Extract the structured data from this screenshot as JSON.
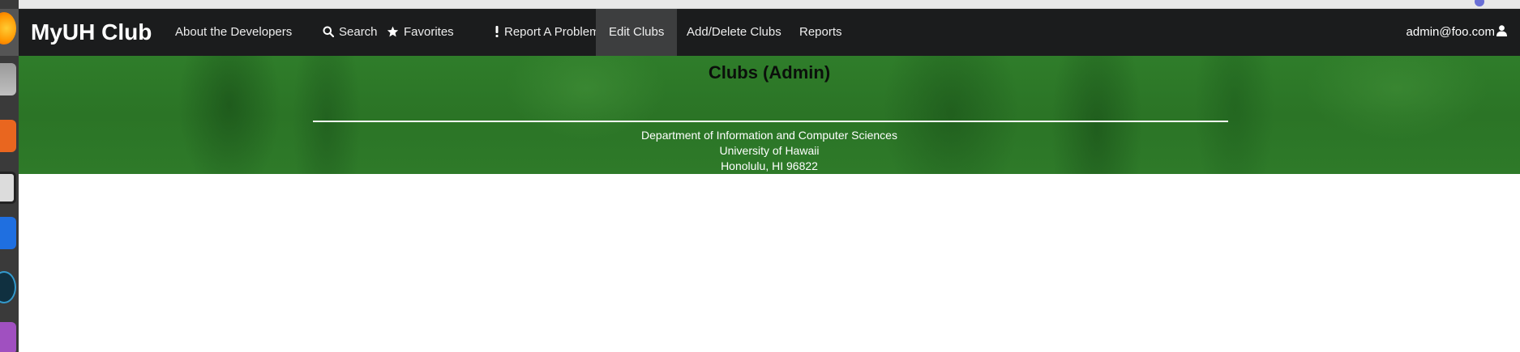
{
  "navbar": {
    "brand": "MyUH Club",
    "items": [
      {
        "label": "About the Developers",
        "icon": ""
      },
      {
        "label": "Search",
        "icon": "search-icon"
      },
      {
        "label": "Favorites",
        "icon": "star-icon"
      },
      {
        "label": "Report A Problem",
        "icon": "exclamation-icon"
      },
      {
        "label": "Edit Clubs",
        "icon": ""
      },
      {
        "label": "Add/Delete Clubs",
        "icon": ""
      },
      {
        "label": "Reports",
        "icon": ""
      }
    ],
    "active": "Edit Clubs",
    "user": "admin@foo.com",
    "user_icon": "user-icon"
  },
  "hero": {
    "title": "Clubs (Admin)"
  },
  "footer": {
    "line1": "Department of Information and Computer Sciences",
    "line2": "University of Hawaii",
    "line3": "Honolulu, HI 96822"
  },
  "colors": {
    "navbar_bg": "#1b1c1d",
    "active_item_bg": "#3d3e3f",
    "hero_green": "#2e7a29"
  }
}
